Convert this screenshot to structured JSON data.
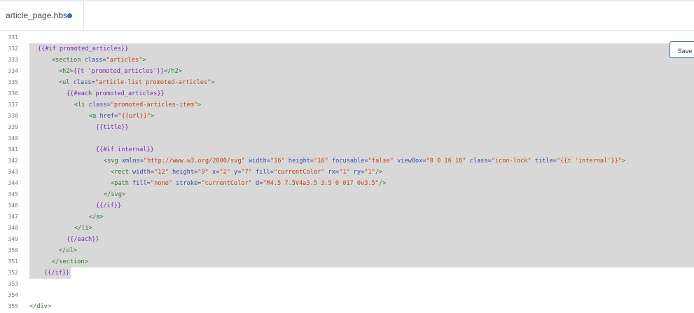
{
  "tab": {
    "filename": "article_page.hbs",
    "unsaved_dot_color": "#2f6fc4"
  },
  "save_label": "Save",
  "colors": {
    "highlight": "#d8d8d8",
    "tag": "#2a7a2a",
    "attr": "#3a4fa0",
    "value": "#c4440f",
    "handlebars": "#7a2ab8"
  },
  "lines": [
    {
      "num": "331",
      "indent": 0,
      "hl": "none",
      "tokens": []
    },
    {
      "num": "332",
      "indent": 12,
      "hl": "full",
      "tokens": [
        [
          "b",
          "{{#if promoted_articles}}"
        ]
      ]
    },
    {
      "num": "333",
      "indent": 32,
      "hl": "full",
      "tokens": [
        [
          "t",
          "<section "
        ],
        [
          "a",
          "class="
        ],
        [
          "v",
          "\"articles\""
        ],
        [
          "t",
          ">"
        ]
      ]
    },
    {
      "num": "334",
      "indent": 42,
      "hl": "full",
      "tokens": [
        [
          "t",
          "<h2>"
        ],
        [
          "b",
          "{{t 'promoted_articles'}}"
        ],
        [
          "t",
          "</h2>"
        ]
      ]
    },
    {
      "num": "335",
      "indent": 42,
      "hl": "full",
      "tokens": [
        [
          "t",
          "<ul "
        ],
        [
          "a",
          "class="
        ],
        [
          "v",
          "\"article-list promoted-articles\""
        ],
        [
          "t",
          ">"
        ]
      ]
    },
    {
      "num": "336",
      "indent": 53,
      "hl": "full",
      "tokens": [
        [
          "b",
          "{{#each promoted_articles}}"
        ]
      ]
    },
    {
      "num": "337",
      "indent": 64,
      "hl": "full",
      "tokens": [
        [
          "t",
          "<li "
        ],
        [
          "a",
          "class="
        ],
        [
          "v",
          "\"promoted-articles-item\""
        ],
        [
          "t",
          ">"
        ]
      ]
    },
    {
      "num": "338",
      "indent": 85,
      "hl": "full",
      "tokens": [
        [
          "t",
          "<a "
        ],
        [
          "a",
          "href="
        ],
        [
          "v",
          "\"{{url}}\""
        ],
        [
          "t",
          ">"
        ]
      ]
    },
    {
      "num": "339",
      "indent": 95,
      "hl": "full",
      "tokens": [
        [
          "b",
          "{{title}}"
        ]
      ]
    },
    {
      "num": "340",
      "indent": 0,
      "hl": "full",
      "tokens": []
    },
    {
      "num": "341",
      "indent": 95,
      "hl": "full",
      "tokens": [
        [
          "b",
          "{{#if internal}}"
        ]
      ]
    },
    {
      "num": "342",
      "indent": 106,
      "hl": "full",
      "tokens": [
        [
          "t",
          "<svg "
        ],
        [
          "a",
          "xmlns="
        ],
        [
          "v",
          "\"http://www.w3.org/2000/svg\""
        ],
        [
          "a",
          " width="
        ],
        [
          "v",
          "\"16\""
        ],
        [
          "a",
          " height="
        ],
        [
          "v",
          "\"16\""
        ],
        [
          "a",
          " focusable="
        ],
        [
          "v",
          "\"false\""
        ],
        [
          "a",
          " viewBox="
        ],
        [
          "v",
          "\"0 0 16 16\""
        ],
        [
          "a",
          " class="
        ],
        [
          "v",
          "\"icon-lock\""
        ],
        [
          "a",
          " title="
        ],
        [
          "v",
          "\"{{t 'internal'}}\""
        ],
        [
          "t",
          ">"
        ]
      ]
    },
    {
      "num": "343",
      "indent": 116,
      "hl": "full",
      "tokens": [
        [
          "t",
          "<rect "
        ],
        [
          "a",
          "width="
        ],
        [
          "v",
          "\"12\""
        ],
        [
          "a",
          " height="
        ],
        [
          "v",
          "\"9\""
        ],
        [
          "a",
          " x="
        ],
        [
          "v",
          "\"2\""
        ],
        [
          "a",
          " y="
        ],
        [
          "v",
          "\"7\""
        ],
        [
          "a",
          " fill="
        ],
        [
          "v",
          "\"currentColor\""
        ],
        [
          "a",
          " rx="
        ],
        [
          "v",
          "\"1\""
        ],
        [
          "a",
          " ry="
        ],
        [
          "v",
          "\"1\""
        ],
        [
          "t",
          "/>"
        ]
      ]
    },
    {
      "num": "344",
      "indent": 116,
      "hl": "full",
      "tokens": [
        [
          "t",
          "<path "
        ],
        [
          "a",
          "fill="
        ],
        [
          "v",
          "\"none\""
        ],
        [
          "a",
          " stroke="
        ],
        [
          "v",
          "\"currentColor\""
        ],
        [
          "a",
          " d="
        ],
        [
          "v",
          "\"M4.5 7.5V4a3.5 3.5 0 017 0v3.5\""
        ],
        [
          "t",
          "/>"
        ]
      ]
    },
    {
      "num": "345",
      "indent": 106,
      "hl": "full",
      "tokens": [
        [
          "t",
          "</svg>"
        ]
      ]
    },
    {
      "num": "346",
      "indent": 95,
      "hl": "full",
      "tokens": [
        [
          "b",
          "{{/if}}"
        ]
      ]
    },
    {
      "num": "347",
      "indent": 85,
      "hl": "full",
      "tokens": [
        [
          "t",
          "</a>"
        ]
      ]
    },
    {
      "num": "348",
      "indent": 64,
      "hl": "full",
      "tokens": [
        [
          "t",
          "</li>"
        ]
      ]
    },
    {
      "num": "349",
      "indent": 53,
      "hl": "full",
      "tokens": [
        [
          "b",
          "{{/each}}"
        ]
      ]
    },
    {
      "num": "350",
      "indent": 42,
      "hl": "full",
      "tokens": [
        [
          "t",
          "</ul>"
        ]
      ]
    },
    {
      "num": "351",
      "indent": 32,
      "hl": "full",
      "tokens": [
        [
          "t",
          "</section>"
        ]
      ]
    },
    {
      "num": "352",
      "indent": 21,
      "hl": "partial",
      "tokens": [
        [
          "b",
          "{{/if}}"
        ]
      ]
    },
    {
      "num": "353",
      "indent": 0,
      "hl": "none",
      "tokens": []
    },
    {
      "num": "354",
      "indent": 0,
      "hl": "none",
      "tokens": []
    },
    {
      "num": "355",
      "indent": 0,
      "hl": "none",
      "tokens": [
        [
          "t",
          "</div>"
        ]
      ]
    }
  ]
}
